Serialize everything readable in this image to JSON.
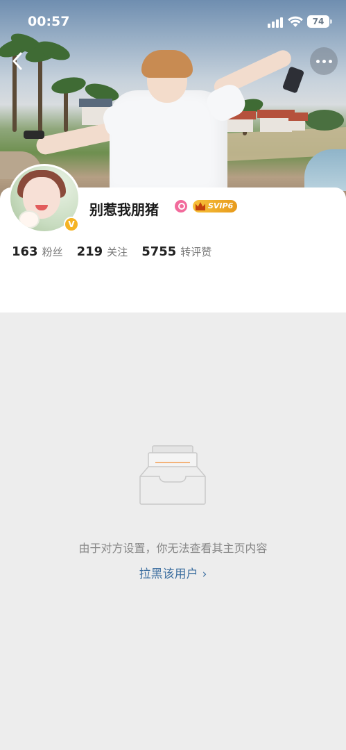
{
  "status_bar": {
    "time": "00:57",
    "battery": "74"
  },
  "profile": {
    "username": "别惹我朋猪",
    "vip_badge": "SVIP6",
    "verified_badge": "V",
    "stats": [
      {
        "count": "163",
        "label": "粉丝"
      },
      {
        "count": "219",
        "label": "关注"
      },
      {
        "count": "5755",
        "label": "转评赞"
      }
    ]
  },
  "empty_state": {
    "message": "由于对方设置，你无法查看其主页内容",
    "action": "拉黑该用户"
  },
  "icons": {
    "back": "chevron-left-icon",
    "more": "more-dots-icon",
    "empty": "inbox-tray-icon",
    "chevron": "chevron-right-icon"
  }
}
